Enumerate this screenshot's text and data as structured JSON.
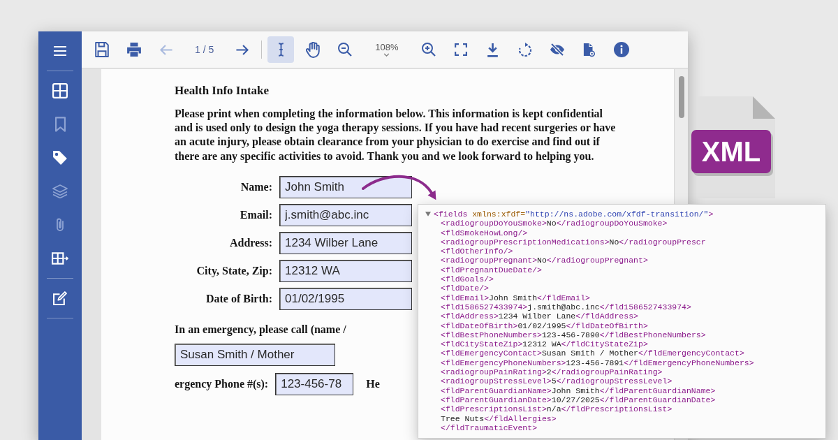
{
  "sidebar": {
    "items": [
      {
        "disabled": false
      },
      {
        "disabled": false
      },
      {
        "disabled": true
      },
      {
        "disabled": false
      },
      {
        "disabled": true
      },
      {
        "disabled": true
      },
      {
        "disabled": false
      },
      {
        "disabled": false
      }
    ]
  },
  "toolbar": {
    "back_button": {
      "disabled": true
    },
    "page_indicator": "1 / 5",
    "forward_button": {
      "disabled": false
    },
    "tools": [
      {
        "selected": true
      },
      {
        "selected": false
      }
    ],
    "zoom_level": "108%"
  },
  "document": {
    "title": "Health Info Intake",
    "intro": "Please print when completing the information below. This information is kept confidential and is used only to design the yoga therapy sessions. If you have had recent surgeries or have an acute injury, please obtain clearance from your physician to do exercise and find out if there are any specific activities to avoid. Thank you and we look forward to helping you.",
    "fields": [
      {
        "label": "Name:",
        "value": "John Smith"
      },
      {
        "label": "Email:",
        "value": "j.smith@abc.inc"
      },
      {
        "label": "Address:",
        "value": "1234 Wilber Lane"
      },
      {
        "label": "City, State, Zip:",
        "value": "12312 WA"
      },
      {
        "label": "Date of Birth:",
        "value": "01/02/1995"
      }
    ],
    "emergency_prompt": "In an emergency, please call (name /",
    "emergency_contact": "Susan Smith / Mother",
    "phone_label": "ergency Phone #(s):",
    "phone_value": "123-456-78",
    "cut_label": "He"
  },
  "file_badge": "XML",
  "xml_panel": {
    "root": {
      "text": "<fields xmlns:xfdf=\"http://ns.adobe.com/xfdf-transition/\">",
      "expanded": true
    },
    "lines": [
      "<radiogroupDoYouSmoke>No</radiogroupDoYouSmoke>",
      "<fldSmokeHowLong/>",
      "<radiogroupPrescriptionMedications>No</radiogroupPrescr",
      "<fldOtherInfo/>",
      "<radiogroupPregnant>No</radiogroupPregnant>",
      "<fldPregnantDueDate/>",
      "<fldGoals/>",
      "<fldDate/>",
      "<fldEmail>John Smith</fldEmail>",
      "<fld1586527433974>j.smith@abc.inc</fld1586527433974>",
      "<fldAddress>1234 Wilber Lane</fldAddress>",
      "<fldDateOfBirth>01/02/1995</fldDateOfBirth>",
      "<fldBestPhoneNumbers>123-456-7890</fldBestPhoneNumbers>",
      "<fldCityStateZip>12312 WA</fldCityStateZip>",
      "<fldEmergencyContact>Susan Smith / Mother</fldEmergencyContact>",
      "<fldEmergencyPhoneNumbers>123-456-7891</fldEmergencyPhoneNumbers>",
      "<radiogroupPainRating>2</radiogroupPainRating>",
      "<radiogroupStressLevel>5</radiogroupStressLevel>",
      "<fldParentGuardianName>John Smith</fldParentGuardianName>",
      "<fldParentGuardianDate>10/27/2025</fldParentGuardianDate>",
      "<fldPrescriptionsList>n/a</fldPrescriptionsList>",
      "Tree Nuts</fldAllergies>",
      "</fldTraumaticEvent>"
    ]
  }
}
